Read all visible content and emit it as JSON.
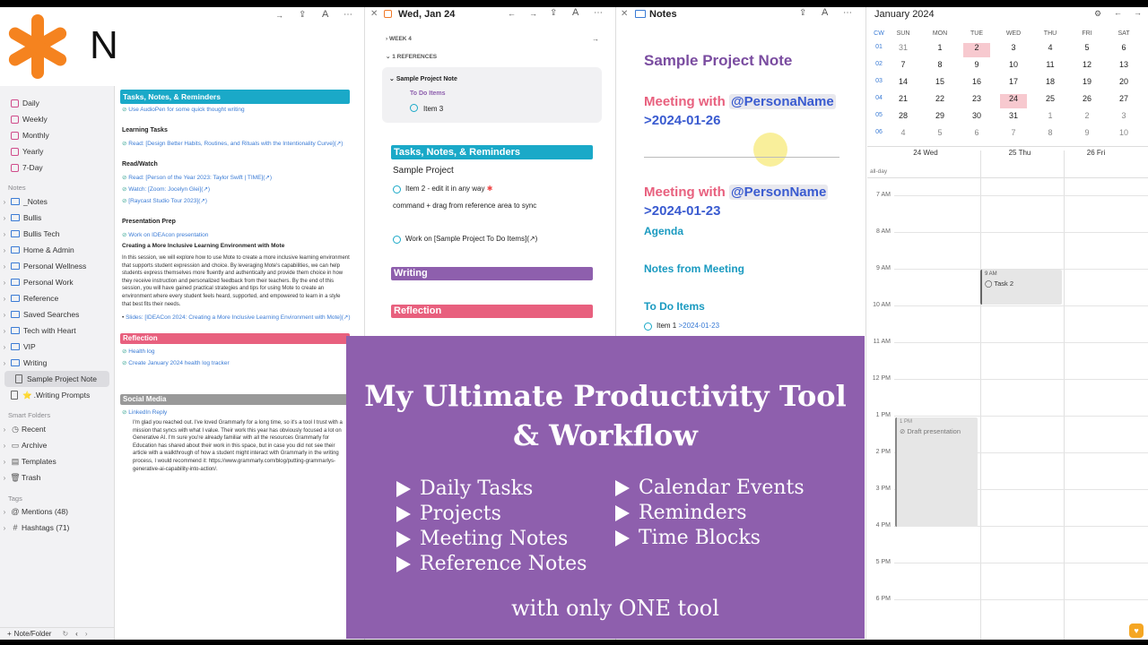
{
  "sidebar": {
    "logo_text": "NotePlan",
    "calendar_items": [
      {
        "label": "Daily"
      },
      {
        "label": "Weekly"
      },
      {
        "label": "Monthly"
      },
      {
        "label": "Yearly"
      },
      {
        "label": "7-Day"
      }
    ],
    "notes_section": "Notes",
    "folders": [
      {
        "label": "_Notes"
      },
      {
        "label": "Bullis"
      },
      {
        "label": "Bullis Tech"
      },
      {
        "label": "Home & Admin"
      },
      {
        "label": "Personal Wellness"
      },
      {
        "label": "Personal Work"
      },
      {
        "label": "Reference"
      },
      {
        "label": "Saved Searches"
      },
      {
        "label": "Tech with Heart"
      },
      {
        "label": "VIP"
      },
      {
        "label": "Writing"
      }
    ],
    "notes": [
      {
        "label": "Sample Project Note"
      },
      {
        "label": ".Writing Prompts"
      }
    ],
    "smart_section": "Smart Folders",
    "smart_items": [
      {
        "label": "Recent"
      },
      {
        "label": "Archive"
      },
      {
        "label": "Templates"
      },
      {
        "label": "Trash"
      }
    ],
    "tags_section": "Tags",
    "tags": [
      {
        "label": "Mentions (48)"
      },
      {
        "label": "Hashtags (71)"
      }
    ],
    "new_label": "Note/Folder"
  },
  "pane1": {
    "h_tasks": "Tasks, Notes, & Reminders",
    "audiopen": "Use AudioPen for some quick thought writing",
    "learning": "Learning Tasks",
    "read1": "Read: [Design Better Habits, Routines, and Rituals with the Intentionality Curve](↗)",
    "readwatch": "Read/Watch",
    "read2": "Read: [Person of the Year 2023: Taylor Swift | TIME](↗)",
    "watch": "Watch: [Zoom: Jocelyn Glei](↗)",
    "raycast": "[Raycast Studio Tour 2023](↗)",
    "prep": "Presentation Prep",
    "ideacon": "Work on IDEAcon presentation",
    "session_title": "Creating a More Inclusive Learning Environment with Mote",
    "session_body": "In this session, we will explore how to use Mote to create a more inclusive learning environment that supports student expression and choice. By leveraging Mote's capabilities, we can help students express themselves more fluently and authentically and provide them choice in how they receive instruction and personalized feedback from their teachers. By the end of this session, you will have gained practical strategies and tips for using Mote to create an environment where every student feels heard, supported, and empowered to learn in a style that best fits their needs.",
    "slides": "Slides: [IDEACon 2024: Creating a More Inclusive Learning Environment with Mote](↗)",
    "h_reflection": "Reflection",
    "health": "Health log",
    "create_log": "Create January 2024 health log tracker",
    "h_social": "Social Media",
    "linkedin": "LinkedIn Reply",
    "reply_body": "I'm glad you reached out. I've loved Grammarly for a long time, so it's a tool I trust with a mission that syncs with what I value. Their work this year has obviously focused a lot on Generative AI. I'm sure you're already familiar with all the resources Grammarly for Education has shared about their work in this space, but in case you did not see their article with a walkthrough of how a student might interact with Grammarly in the writing process, I would recommend it: https://www.grammarly.com/blog/putting-grammarlys-generative-ai-capability-into-action/."
  },
  "pane2": {
    "date": "Wed, Jan 24",
    "week": "WEEK 4",
    "refs": "1 REFERENCES",
    "ref_note": "Sample Project Note",
    "ref_sub": "To Do Items",
    "ref_item": "Item 3",
    "h_tasks": "Tasks, Notes, & Reminders",
    "project": "Sample Project",
    "item2": "Item 2 - edit it in any way",
    "drag": "command + drag from reference area to sync",
    "work_on": "Work on [Sample Project To Do Items](↗)",
    "h_writing": "Writing",
    "h_reflection": "Reflection"
  },
  "pane3": {
    "title": "Notes",
    "note_title": "Sample Project Note",
    "meeting1_prefix": "Meeting with",
    "meeting1_mention": "@PersonaName",
    "meeting1_date": ">2024-01-26",
    "meeting2_prefix": "Meeting with",
    "meeting2_mention": "@PersonName",
    "meeting2_date": ">2024-01-23",
    "agenda": "Agenda",
    "notes_from": "Notes from Meeting",
    "todo": "To Do Items",
    "item1": "Item 1",
    "item1_date": ">2024-01-23"
  },
  "calendar": {
    "month": "January 2024",
    "cw": "CW",
    "days": [
      "SUN",
      "MON",
      "TUE",
      "WED",
      "THU",
      "FRI",
      "SAT"
    ],
    "weeks": [
      {
        "wk": "01",
        "d": [
          "31",
          "1",
          "2",
          "3",
          "4",
          "5",
          "6"
        ]
      },
      {
        "wk": "02",
        "d": [
          "7",
          "8",
          "9",
          "10",
          "11",
          "12",
          "13"
        ]
      },
      {
        "wk": "03",
        "d": [
          "14",
          "15",
          "16",
          "17",
          "18",
          "19",
          "20"
        ]
      },
      {
        "wk": "04",
        "d": [
          "21",
          "22",
          "23",
          "24",
          "25",
          "26",
          "27"
        ]
      },
      {
        "wk": "05",
        "d": [
          "28",
          "29",
          "30",
          "31",
          "1",
          "2",
          "3"
        ]
      },
      {
        "wk": "06",
        "d": [
          "4",
          "5",
          "6",
          "7",
          "8",
          "9",
          "10"
        ]
      }
    ],
    "col_heads": [
      "24 Wed",
      "25 Thu",
      "26 Fri"
    ],
    "allday": "all-day",
    "hours": [
      "7 AM",
      "8 AM",
      "9 AM",
      "10 AM",
      "11 AM",
      "12 PM",
      "1 PM",
      "2 PM",
      "3 PM",
      "4 PM",
      "5 PM",
      "6 PM"
    ],
    "ev1_time": "9 AM",
    "ev1_title": "Task 2",
    "ev2_time": "1 PM",
    "ev2_title": "Draft presentation"
  },
  "overlay": {
    "title1": "My Ultimate Productivity Tool",
    "title2": "& Workflow",
    "left": [
      "Daily Tasks",
      "Projects",
      "Meeting Notes",
      "Reference Notes"
    ],
    "right": [
      "Calendar Events",
      "Reminders",
      "Time Blocks"
    ],
    "footer": "with only ONE tool"
  },
  "colors": {
    "teal": "#1aa9c8",
    "purple": "#8e5fad",
    "pink": "#e8607e",
    "highlight": "#f7c9cf"
  }
}
